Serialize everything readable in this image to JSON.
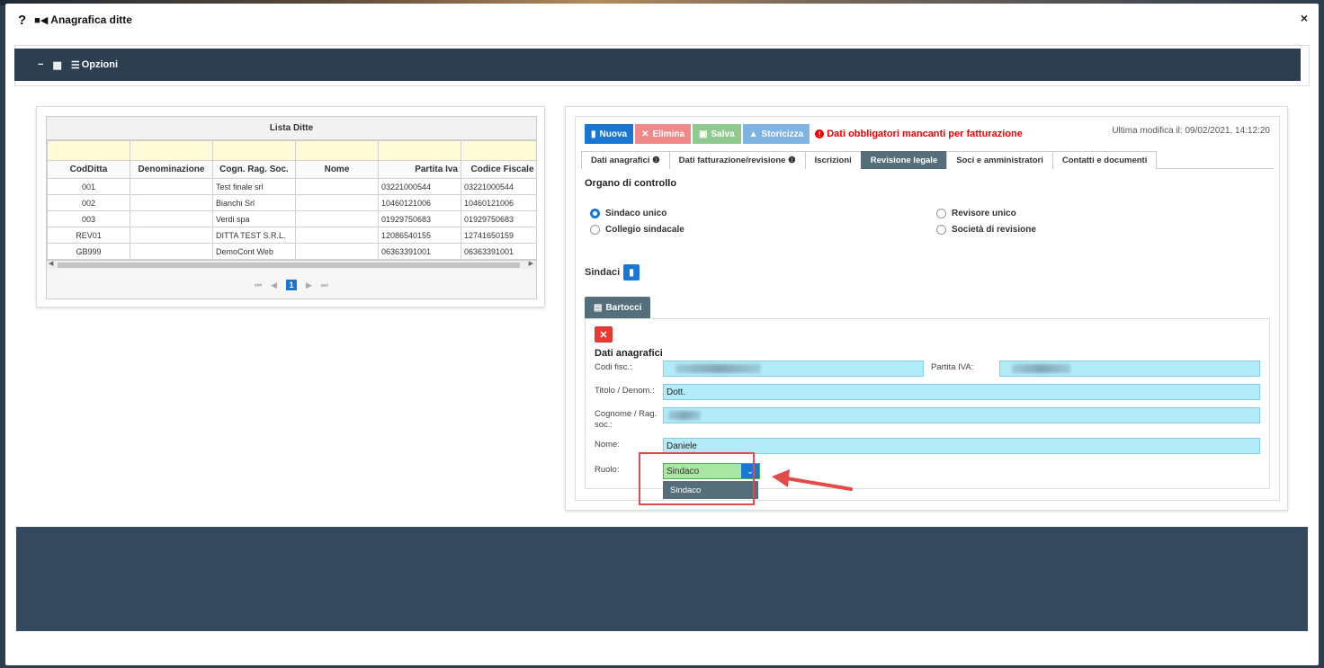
{
  "modal": {
    "help_icon": "?",
    "video_icon": "■◀",
    "title": "Anagrafica ditte",
    "close": "×"
  },
  "options_bar": {
    "minus_icon": "−",
    "building_icon": "▦",
    "options_icon": "☰",
    "label": "Opzioni"
  },
  "ditte_grid": {
    "caption": "Lista Ditte",
    "columns": [
      "CodDitta",
      "Denominazione",
      "Cogn. Rag. Soc.",
      "Nome",
      "Partita Iva",
      "Codice Fiscale"
    ],
    "rows": [
      [
        "001",
        "",
        "Test finale srl",
        "",
        "03221000544",
        "03221000544"
      ],
      [
        "002",
        "",
        "Bianchi Srl",
        "",
        "10460121006",
        "10460121006"
      ],
      [
        "003",
        "",
        "Verdi spa",
        "",
        "01929750683",
        "01929750683"
      ],
      [
        "REV01",
        "",
        "DITTA TEST S.R.L.",
        "",
        "12086540155",
        "12741650159"
      ],
      [
        "GB999",
        "",
        "DemoCont Web",
        "",
        "06363391001",
        "06363391001"
      ]
    ],
    "pager": {
      "first": "⏮",
      "prev": "◀",
      "current": "1",
      "next": "▶",
      "last": "⏭"
    }
  },
  "toolbar": {
    "nuova": "Nuova",
    "elimina": "Elimina",
    "salva": "Salva",
    "storicizza": "Storicizza",
    "warning": "Dati obbligatori mancanti per fatturazione",
    "last_modified": "Ultima modifica il: 09/02/2021, 14:12:20"
  },
  "tabs": [
    "Dati anagrafici",
    "Dati fatturazione/revisione",
    "Iscrizioni",
    "Revisione legale",
    "Soci e amministratori",
    "Contatti e documenti"
  ],
  "active_tab": "Revisione legale",
  "organo": {
    "title": "Organo di controllo",
    "opt_sindaco_unico": "Sindaco unico",
    "opt_collegio": "Collegio sindacale",
    "opt_revisore": "Revisore unico",
    "opt_societa": "Società di revisione",
    "selected": "Sindaco unico"
  },
  "sindaci": {
    "title": "Sindaci",
    "person_tab": "Bartocci",
    "section_title": "Dati anagrafici",
    "cod_fisc_label": "Codi fisc.:",
    "partita_iva_label": "Partita IVA:",
    "titolo_label": "Titolo / Denom.:",
    "titolo_value": "Dott.",
    "cognome_label": "Cognome / Rag. soc.:",
    "nome_label": "Nome:",
    "nome_value": "Daniele",
    "ruolo_label": "Ruolo:",
    "ruolo_value": "Sindaco",
    "ruolo_options": [
      "Sindaco"
    ]
  },
  "colors": {
    "dark": "#2c3e50",
    "primary": "#1976d2",
    "active_tab": "#546e7a",
    "field_bg": "#b3ecf9",
    "select_bg": "#a8e6a1",
    "warning": "#e00000",
    "annotation": "#e34a4a"
  }
}
